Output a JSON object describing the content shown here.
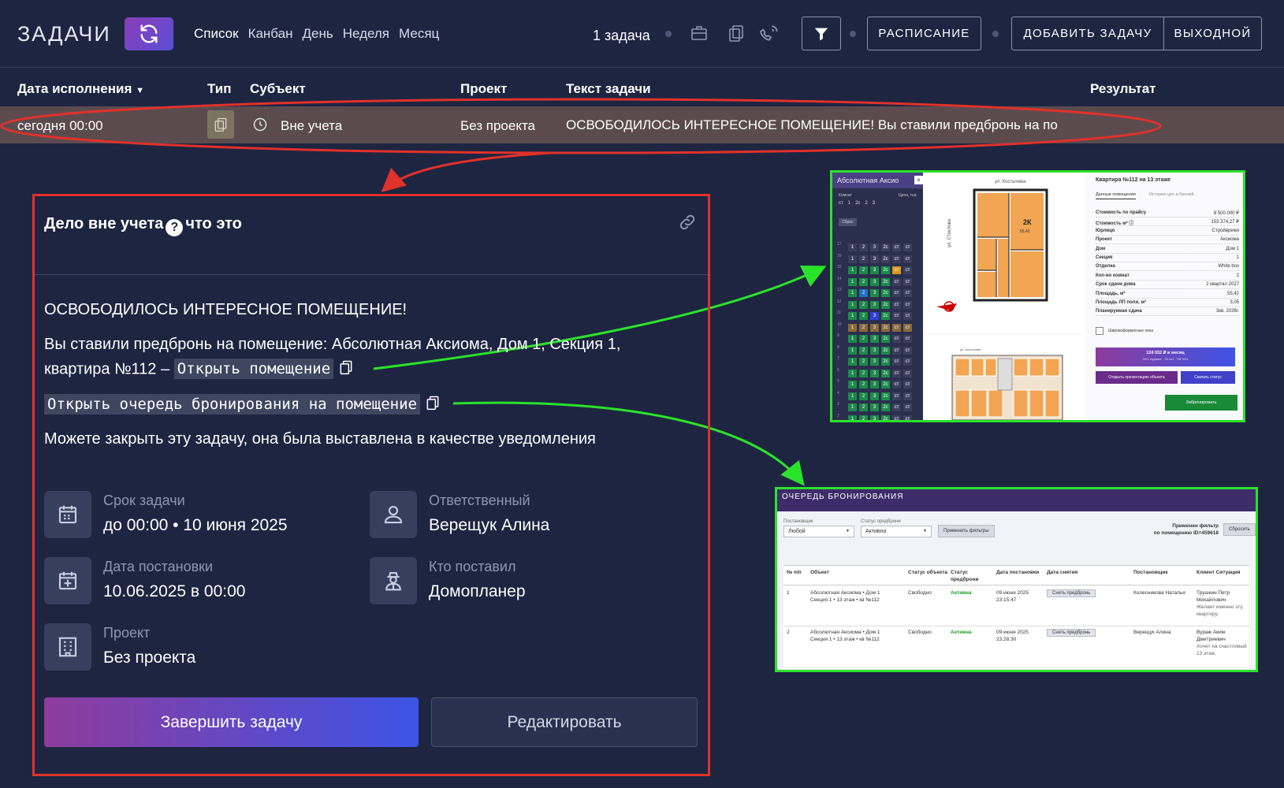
{
  "header": {
    "app_title": "ЗАДАЧИ",
    "views": [
      "Список",
      "Канбан",
      "День",
      "Неделя",
      "Месяц"
    ],
    "task_count": "1 задача",
    "schedule_button": "РАСПИСАНИЕ",
    "add_task_button": "ДОБАВИТЬ ЗАДАЧУ",
    "day_off_button": "ВЫХОДНОЙ"
  },
  "table": {
    "columns": {
      "due_date": "Дата исполнения",
      "type": "Тип",
      "subject": "Субъект",
      "project": "Проект",
      "text": "Текст задачи",
      "result": "Результат"
    },
    "row": {
      "due_date": "сегодня 00:00",
      "subject": "Вне учета",
      "project": "Без проекта",
      "text": "ОСВОБОДИЛОСЬ ИНТЕРЕСНОЕ ПОМЕЩЕНИЕ! Вы ставили предбронь на по"
    }
  },
  "panel": {
    "title": "Дело вне учета",
    "title_suffix": "что это",
    "heading": "ОСВОБОДИЛОСЬ ИНТЕРЕСНОЕ ПОМЕЩЕНИЕ!",
    "body_line1": "Вы ставили предбронь на помещение: Абсолютная Аксиома, Дом 1, Секция 1,",
    "body_line2": "квартира №112 –",
    "open_room_link": "Открыть помещение",
    "open_queue_link": "Открыть очередь бронирования на помещение",
    "note": "Можете закрыть эту задачу, она была выставлена в качестве уведомления",
    "meta": {
      "deadline_label": "Срок задачи",
      "deadline_value": "до 00:00 • 10 июня 2025",
      "responsible_label": "Ответственный",
      "responsible_value": "Верещук Алина",
      "created_label": "Дата постановки",
      "created_value": "10.06.2025 в 00:00",
      "creator_label": "Кто поставил",
      "creator_value": "Домопланер",
      "project_label": "Проект",
      "project_value": "Без проекта"
    },
    "complete_button": "Завершить задачу",
    "edit_button": "Редактировать"
  },
  "apartment_screenshot": {
    "complex_name": "Абсолютная Аксио",
    "street_top": "ул. Костычева",
    "street_side": "ул. Стеклова",
    "street_bottom": "ул. Костычева",
    "filter_rooms_label": "Комнат",
    "filter_price_label": "Цена, тыс",
    "room_options": [
      "ст",
      "1",
      "2с",
      "2",
      "3"
    ],
    "reset_label": "Сброс",
    "floors": [
      "17",
      "16",
      "15",
      "14",
      "13",
      "12",
      "11",
      "10",
      "9",
      "8",
      "7",
      "6",
      "5",
      "4",
      "3",
      "2"
    ],
    "room_type_label": "2К",
    "room_area": "55,42",
    "title": "Квартира №112 на 13 этаже",
    "tab_active": "Данные помещения",
    "tab_other": "История цен и броней",
    "rows": [
      {
        "k": "Стоимость по прайсу",
        "v": "8 500 000 ₽"
      },
      {
        "k": "Стоимость м² ⓘ",
        "v": "153 374,27 ₽"
      },
      {
        "k": "Юрлицо",
        "v": "Стройвремя"
      },
      {
        "k": "Проект",
        "v": "Аксиома"
      },
      {
        "k": "Дом",
        "v": "Дом 1"
      },
      {
        "k": "Секция",
        "v": "1"
      },
      {
        "k": "Отделка",
        "v": "White box"
      },
      {
        "k": "Кол-во комнат",
        "v": "2"
      },
      {
        "k": "Срок сдачи дома",
        "v": "2 квартал 2027"
      },
      {
        "k": "Площадь, м²",
        "v": "55,42"
      },
      {
        "k": "Площадь ЛП поли, м²",
        "v": "3,05"
      },
      {
        "k": "Планируемая сдача",
        "v": "3кв. 2026г."
      }
    ],
    "feature": "Широкоформатные окна",
    "mortgage_amount": "124 032 ₽ в месяц",
    "mortgage_terms": "25% годовых · 30 лет · ПВ 30%",
    "presentation_button": "Открыть презентацию объекта",
    "download_button": "Скачать статус",
    "book_button": "Забронировать"
  },
  "queue_screenshot": {
    "title": "ОЧЕРЕДЬ БРОНИРОВАНИЯ",
    "filter_creator_label": "Постановщик",
    "filter_creator_value": "Любой",
    "filter_status_label": "Статус предброни",
    "filter_status_value": "Активна",
    "apply_button": "Применить фильтры",
    "applied_filter_line1": "Применен фильтр",
    "applied_filter_line2": "по помещению ID=459618",
    "reset_button": "Сбросить",
    "columns": [
      "№ п/п",
      "Объект",
      "Статус объекта",
      "Статус предброни",
      "Дата постановки",
      "Дата снятия",
      "Постановщик",
      "Клиент Ситуация"
    ],
    "rows": [
      {
        "num": "1",
        "object": "Абсолютная Аксиома • Дом 1",
        "object_sub": "Секция 1 • 13 этаж • кв №112",
        "object_status": "Свободно",
        "booking_status": "Активна",
        "date": "09 июня 2025",
        "time": "23:15:47",
        "remove": "Снять предбронь",
        "creator": "Колесникова Наталья",
        "client": "Трушкин Петр Михайлович",
        "situation": "Желает именно эту квартиру."
      },
      {
        "num": "2",
        "object": "Абсолютная Аксиома • Дом 1",
        "object_sub": "Секция 1 • 13 этаж • кв №112",
        "object_status": "Свободно",
        "booking_status": "Активна",
        "date": "09 июня 2025",
        "time": "23:28:30",
        "remove": "Снять предбронь",
        "creator": "Верещук Алина",
        "client": "Вураж Аким Дмитриевич",
        "situation": "Хочет на счастливый 13 этаж."
      }
    ]
  },
  "colors": {
    "background": "#1e2541",
    "highlight_row": "#5b4b4f",
    "annotation_red": "#e0312a",
    "annotation_green": "#2be22b",
    "accent_gradient_start": "#8e3b9c",
    "accent_gradient_end": "#3d54e6"
  },
  "icons": [
    "sync-icon",
    "briefcase-icon",
    "clipboard-icon",
    "phone-icon",
    "filter-icon",
    "copy-icon",
    "clock-icon",
    "link-icon",
    "calendar-icon",
    "user-icon",
    "calendar-plus-icon",
    "agent-icon",
    "building-icon"
  ]
}
